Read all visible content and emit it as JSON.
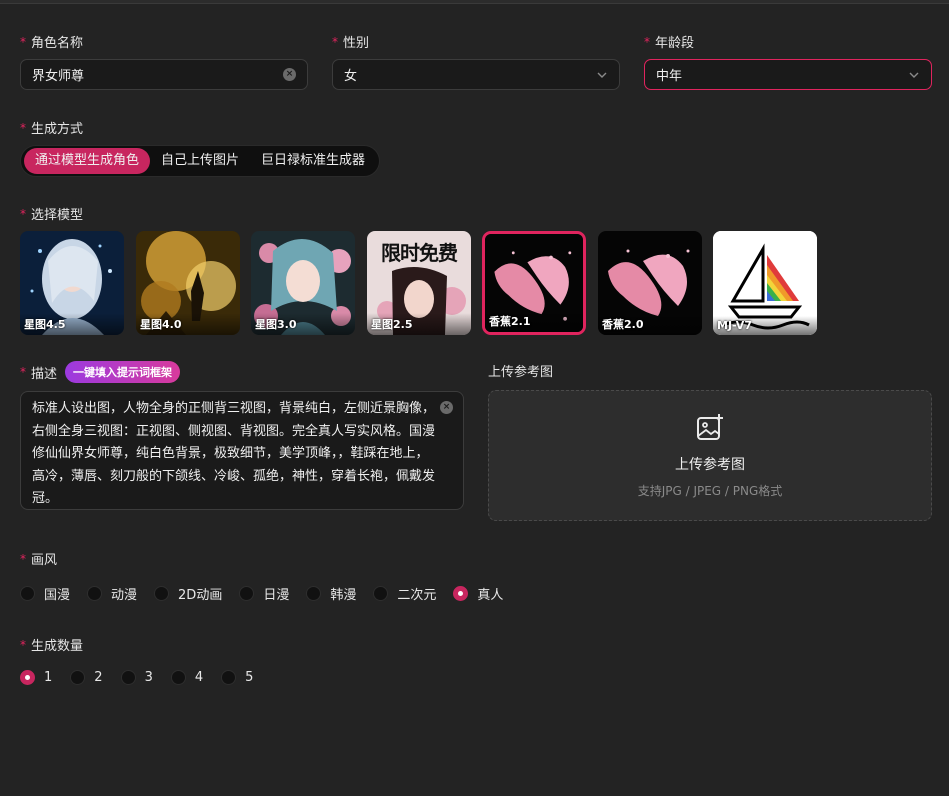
{
  "form": {
    "role_name": {
      "label": "角色名称",
      "value": "界女师尊"
    },
    "gender": {
      "label": "性别",
      "value": "女"
    },
    "age": {
      "label": "年龄段",
      "value": "中年"
    },
    "gen_method": {
      "label": "生成方式",
      "options": [
        "通过模型生成角色",
        "自己上传图片",
        "巨日禄标准生成器"
      ],
      "selected": "通过模型生成角色"
    },
    "model": {
      "label": "选择模型",
      "items": [
        {
          "name": "星图4.5",
          "icon": "model-thumb-silver-hair-girl"
        },
        {
          "name": "星图4.0",
          "icon": "model-thumb-golden-battle"
        },
        {
          "name": "星图3.0",
          "icon": "model-thumb-flower-fairy"
        },
        {
          "name": "星图2.5",
          "icon": "model-thumb-limited-free",
          "badge": "限时免费"
        },
        {
          "name": "香蕉2.1",
          "icon": "model-thumb-pink-banana"
        },
        {
          "name": "香蕉2.0",
          "icon": "model-thumb-pink-banana"
        },
        {
          "name": "MJ-V7",
          "icon": "model-thumb-sailboat-logo"
        }
      ],
      "selected": "香蕉2.1"
    },
    "description": {
      "label": "描述",
      "fill_button": "一键填入提示词框架",
      "value": "标准人设出图，人物全身的正侧背三视图，背景纯白，左侧近景胸像，右侧全身三视图：正视图、侧视图、背视图。完全真人写实风格。国漫修仙仙界女师尊，纯白色背景，极致细节，美学顶峰，，鞋踩在地上，高冷，薄唇、刻刀般的下颌线、冷峻、孤绝，神性，穿着长袍，佩戴发冠。"
    },
    "upload": {
      "label": "上传参考图",
      "title": "上传参考图",
      "hint": "支持JPG / JPEG / PNG格式",
      "icon": "image-plus-icon"
    },
    "style": {
      "label": "画风",
      "options": [
        "国漫",
        "动漫",
        "2D动画",
        "日漫",
        "韩漫",
        "二次元",
        "真人"
      ],
      "selected": "真人"
    },
    "count": {
      "label": "生成数量",
      "options": [
        "1",
        "2",
        "3",
        "4",
        "5"
      ],
      "selected": "1"
    }
  },
  "colors": {
    "accent": "#e0245e",
    "background": "#232323",
    "field": "#1a1a1a"
  }
}
